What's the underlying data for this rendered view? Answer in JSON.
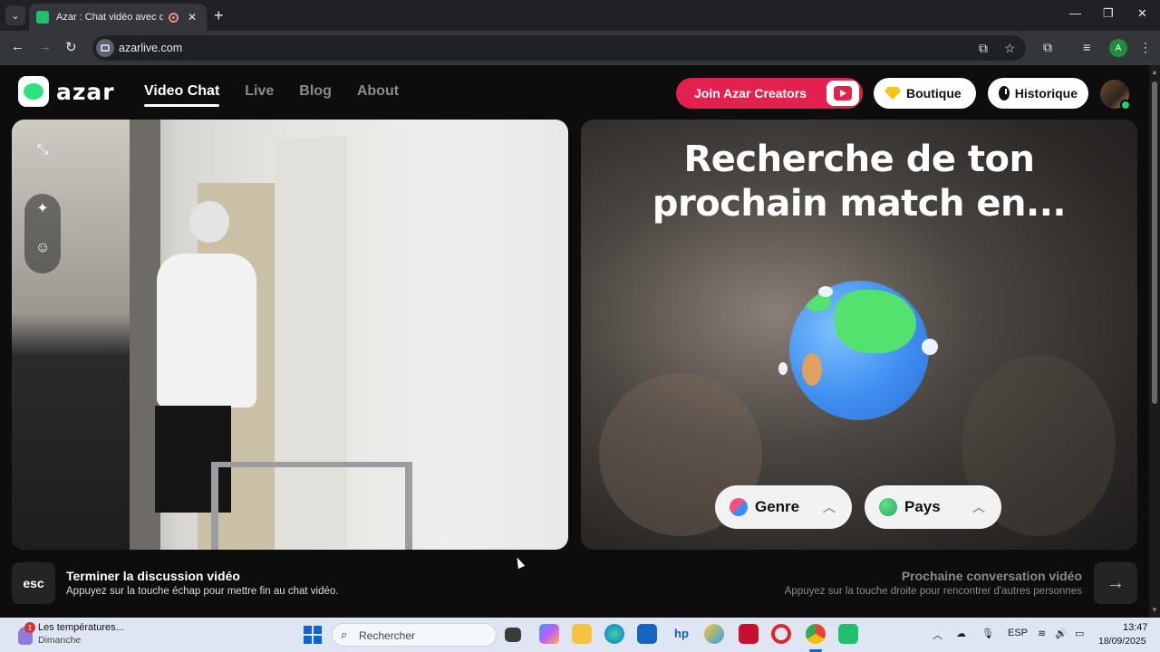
{
  "browser": {
    "tab_title": "Azar : Chat vidéo avec de n",
    "url": "azarlive.com",
    "profile_initial": "A"
  },
  "site": {
    "logo": "azar",
    "nav": [
      "Video Chat",
      "Live",
      "Blog",
      "About"
    ],
    "active_nav": "Video Chat",
    "join_creators": "Join Azar Creators",
    "boutique": "Boutique",
    "historique": "Historique"
  },
  "matching": {
    "headline_line1": "Recherche de ton",
    "headline_line2": "prochain match en...",
    "filter_gender": "Genre",
    "filter_country": "Pays"
  },
  "controls": {
    "esc_key": "esc",
    "end_title": "Terminer la discussion vidéo",
    "end_subtitle": "Appuyez sur la touche échap pour mettre fin au chat vidéo.",
    "next_title": "Prochaine conversation vidéo",
    "next_subtitle": "Appuyez sur la touche droite pour rencontrer d'autres personnes"
  },
  "taskbar": {
    "weather_title": "Les températures...",
    "weather_subtitle": "Dimanche",
    "weather_badge": "1",
    "search_placeholder": "Rechercher",
    "language": "ESP",
    "time": "13:47",
    "date": "18/09/2025"
  },
  "colors": {
    "accent_red": "#e3214f",
    "brand_green": "#2ee37f",
    "panel_dark": "#242424"
  }
}
